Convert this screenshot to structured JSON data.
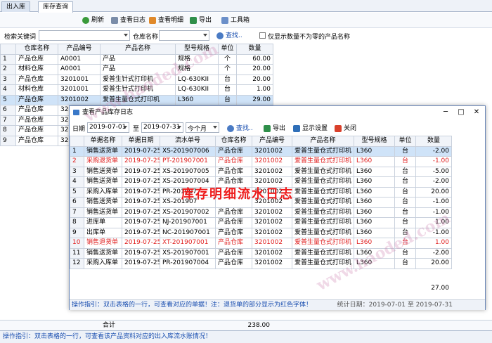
{
  "tabs": [
    "出入库",
    "库存查询"
  ],
  "toolbar": {
    "refresh": "刷新",
    "view_log": "查看日志",
    "view_detail": "查看明细",
    "export": "导出",
    "toolbox": "工具箱"
  },
  "filter": {
    "keyword_label": "检索关键词",
    "warehouse_label": "仓库名称",
    "search": "查找..",
    "only_nonzero": "仅显示数量不为零的产品名称"
  },
  "main_table": {
    "headers": [
      "",
      "仓库名称",
      "产品编号",
      "产品名称",
      "型号规格",
      "单位",
      "数量"
    ],
    "rows": [
      [
        "1",
        "产品仓库",
        "A0001",
        "产品",
        "规格",
        "个",
        "60.00"
      ],
      [
        "2",
        "材料仓库",
        "A0001",
        "产品",
        "规格",
        "个",
        "20.00"
      ],
      [
        "3",
        "产品仓库",
        "3201001",
        "爱普生针式打印机",
        "LQ-630KII",
        "台",
        "20.00"
      ],
      [
        "4",
        "材料仓库",
        "3201001",
        "爱普生针式打印机",
        "LQ-630KII",
        "台",
        "1.00"
      ],
      [
        "5",
        "产品仓库",
        "3201002",
        "爱普生量仓式打印机",
        "L360",
        "台",
        "29.00"
      ],
      [
        "6",
        "产品仓库",
        "320",
        "",
        "",
        "",
        ""
      ],
      [
        "7",
        "产品仓库",
        "320",
        "",
        "",
        "",
        ""
      ],
      [
        "8",
        "产品仓库",
        "320",
        "",
        "",
        "",
        ""
      ],
      [
        "9",
        "产品仓库",
        "320",
        "",
        "",
        "",
        ""
      ]
    ],
    "total_label": "合计",
    "total_value": "238.00"
  },
  "main_status": "操作指引：双击表格的一行，可查看该产品资料对应的出入库流水账情况！",
  "dialog": {
    "title": "查看产品库存日志",
    "date_label": "日期",
    "date_from": "2019-07-01",
    "to_label": "至",
    "date_to": "2019-07-31",
    "period": "今个月",
    "search": "查找..",
    "export": "导出",
    "display_settings": "显示设置",
    "close": "关闭",
    "headers": [
      "",
      "单据名称",
      "单据日期",
      "流水单号",
      "仓库名称",
      "产品编号",
      "产品名称",
      "型号规格",
      "单位",
      "数量"
    ],
    "rows": [
      [
        "1",
        "销售送货单",
        "2019-07-25",
        "XS-201907006",
        "产品仓库",
        "3201002",
        "爱普生量仓式打印机",
        "L360",
        "台",
        "-2.00"
      ],
      [
        "2",
        "采购退货单",
        "2019-07-25",
        "PT-201907001",
        "产品仓库",
        "3201002",
        "爱普生量仓式打印机",
        "L360",
        "台",
        "-1.00"
      ],
      [
        "3",
        "销售送货单",
        "2019-07-25",
        "XS-201907005",
        "产品仓库",
        "3201002",
        "爱普生量仓式打印机",
        "L360",
        "台",
        "-5.00"
      ],
      [
        "4",
        "销售送货单",
        "2019-07-25",
        "XS-201907004",
        "产品仓库",
        "3201002",
        "爱普生量仓式打印机",
        "L360",
        "台",
        "-2.00"
      ],
      [
        "5",
        "采购入库单",
        "2019-07-25",
        "PR-201907",
        "",
        "3201002",
        "爱普生量仓式打印机",
        "L360",
        "台",
        "20.00"
      ],
      [
        "6",
        "销售送货单",
        "2019-07-25",
        "XS-201907",
        "",
        "3201002",
        "爱普生量仓式打印机",
        "L360",
        "台",
        "-1.00"
      ],
      [
        "7",
        "销售送货单",
        "2019-07-25",
        "XS-201907002",
        "产品仓库",
        "3201002",
        "爱普生量仓式打印机",
        "L360",
        "台",
        "-1.00"
      ],
      [
        "8",
        "进库单",
        "2019-07-25",
        "NJ-201907001",
        "产品仓库",
        "3201002",
        "爱普生量仓式打印机",
        "L360",
        "台",
        "1.00"
      ],
      [
        "9",
        "出库单",
        "2019-07-25",
        "NC-201907001",
        "产品仓库",
        "3201002",
        "爱普生量仓式打印机",
        "L360",
        "台",
        "-1.00"
      ],
      [
        "10",
        "销售退货单",
        "2019-07-25",
        "XT-201907001",
        "产品仓库",
        "3201002",
        "爱普生量仓式打印机",
        "L360",
        "台",
        "1.00"
      ],
      [
        "11",
        "销售送货单",
        "2019-07-25",
        "XS-201907001",
        "产品仓库",
        "3201002",
        "爱普生量仓式打印机",
        "L360",
        "台",
        "-2.00"
      ],
      [
        "12",
        "采购入库单",
        "2019-07-25",
        "PR-201907004",
        "产品仓库",
        "3201002",
        "爱普生量仓式打印机",
        "L360",
        "台",
        "20.00"
      ]
    ],
    "red_rows": [
      1,
      9
    ],
    "total": "27.00",
    "status": "操作指引：双击表格的一行，可查看对应的单据！注：退货单的部分显示为红色字体！",
    "stats": "统计日期：2019-07-01 至 2019-07-31"
  },
  "overlay_title": "库存明细流水日志",
  "watermark": "www.haoded.com",
  "colors": {
    "accent_blue": "#1a4fb0",
    "red": "#e02020",
    "selected_row": "#cfe3f8"
  }
}
